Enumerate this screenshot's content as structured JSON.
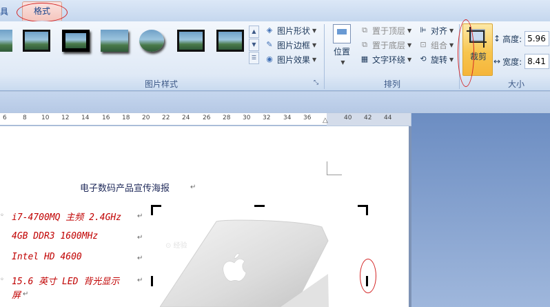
{
  "tabs": {
    "left_partial": "具",
    "format": "格式"
  },
  "picture_styles": {
    "label": "图片样式",
    "shape": "图片形状",
    "border": "图片边框",
    "effects": "图片效果"
  },
  "arrange": {
    "label": "排列",
    "position": "位置",
    "bring_front": "置于顶层",
    "send_back": "置于底层",
    "text_wrap": "文字环绕",
    "align": "对齐",
    "group": "组合",
    "rotate": "旋转"
  },
  "size": {
    "label": "大小",
    "crop": "裁剪",
    "height_label": "高度:",
    "height_value": "5.96",
    "width_label": "宽度:",
    "width_value": "8.41"
  },
  "ruler": [
    "6",
    "8",
    "10",
    "12",
    "14",
    "16",
    "18",
    "20",
    "22",
    "24",
    "26",
    "28",
    "30",
    "32",
    "34",
    "36",
    "40",
    "42",
    "44"
  ],
  "document": {
    "title": "电子数码产品宣传海报",
    "specs": [
      "i7-4700MQ 主频 2.4GHz",
      "4GB DDR3 1600MHz",
      "Intel HD 4600",
      "15.6 英寸 LED 背光显示",
      "屏"
    ]
  },
  "colors": {
    "accent_red": "#d42424",
    "spec_text": "#c00000",
    "ribbon_text": "#1e395b"
  }
}
